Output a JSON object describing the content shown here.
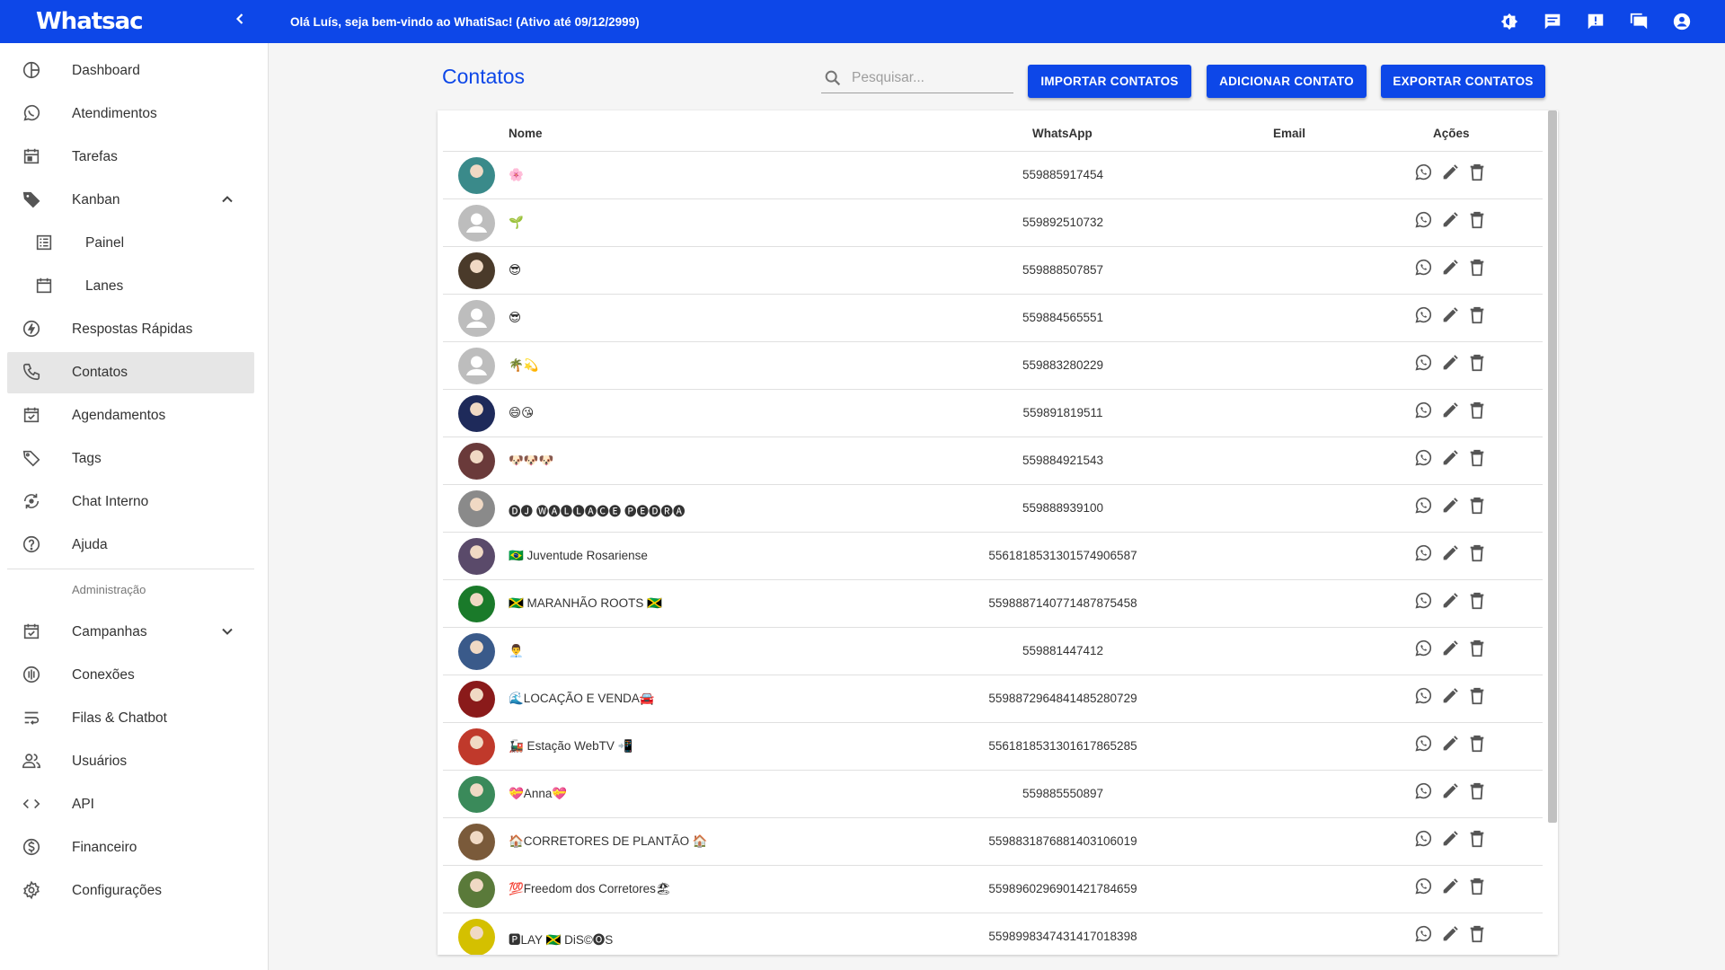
{
  "app": {
    "logo_text": "Whatsac",
    "welcome": "Olá Luís, seja bem-vindo ao WhatiSac! (Ativo até 09/12/2999)",
    "brand_color": "#0d47e8"
  },
  "topbar_icons": [
    "theme-toggle-icon",
    "chat-icon",
    "announcement-icon",
    "forum-icon",
    "account-circle-icon"
  ],
  "sidebar": {
    "items": [
      {
        "label": "Dashboard",
        "icon": "dashboard-icon"
      },
      {
        "label": "Atendimentos",
        "icon": "whatsapp-icon"
      },
      {
        "label": "Tarefas",
        "icon": "calendar-icon"
      },
      {
        "label": "Kanban",
        "icon": "tag-icon"
      },
      {
        "label": "Painel",
        "icon": "list-icon"
      },
      {
        "label": "Lanes",
        "icon": "calendar-blank-icon"
      },
      {
        "label": "Respostas Rápidas",
        "icon": "flash-icon"
      },
      {
        "label": "Contatos",
        "icon": "phone-icon"
      },
      {
        "label": "Agendamentos",
        "icon": "event-check-icon"
      },
      {
        "label": "Tags",
        "icon": "tag-outline-icon"
      },
      {
        "label": "Chat Interno",
        "icon": "chat-sync-icon"
      },
      {
        "label": "Ajuda",
        "icon": "help-icon"
      },
      {
        "label": "Campanhas",
        "icon": "event-available-icon"
      },
      {
        "label": "Conexões",
        "icon": "signal-icon"
      },
      {
        "label": "Filas & Chatbot",
        "icon": "wrap-text-icon"
      },
      {
        "label": "Usuários",
        "icon": "people-icon"
      },
      {
        "label": "API",
        "icon": "code-icon"
      },
      {
        "label": "Financeiro",
        "icon": "dollar-icon"
      },
      {
        "label": "Configurações",
        "icon": "settings-icon"
      }
    ],
    "section_admin": "Administração",
    "active_item": "Contatos"
  },
  "main": {
    "title": "Contatos",
    "search_placeholder": "Pesquisar...",
    "buttons": {
      "import": "IMPORTAR CONTATOS",
      "add": "ADICIONAR CONTATO",
      "export": "EXPORTAR CONTATOS"
    },
    "columns": {
      "name": "Nome",
      "whatsapp": "WhatsApp",
      "email": "Email",
      "actions": "Ações"
    }
  },
  "contacts": [
    {
      "name": "🌸",
      "whatsapp": "559885917454",
      "email": "",
      "avatar": "photo",
      "color": "#3a8a8a"
    },
    {
      "name": "🌱",
      "whatsapp": "559892510732",
      "email": "",
      "avatar": "default",
      "color": "#bdbdbd"
    },
    {
      "name": "😎",
      "whatsapp": "559888507857",
      "email": "",
      "avatar": "photo",
      "color": "#4a3a2a"
    },
    {
      "name": "😎",
      "whatsapp": "559884565551",
      "email": "",
      "avatar": "default",
      "color": "#bdbdbd"
    },
    {
      "name": "🌴💫",
      "whatsapp": "559883280229",
      "email": "",
      "avatar": "default",
      "color": "#bdbdbd"
    },
    {
      "name": "😄😘",
      "whatsapp": "559891819511",
      "email": "",
      "avatar": "photo",
      "color": "#1e2a5a"
    },
    {
      "name": "🐶🐶🐶",
      "whatsapp": "559884921543",
      "email": "",
      "avatar": "photo",
      "color": "#6a3a3a"
    },
    {
      "name": "🅓🅙 🅦🅐🅛🅛🅐🅒🅔 🅟🅔🅓🅡🅐",
      "whatsapp": "559888939100",
      "email": "",
      "avatar": "photo",
      "color": "#8a8a8a"
    },
    {
      "name": "🇧🇷 Juventude Rosariense",
      "whatsapp": "5561818531301574906587",
      "email": "",
      "avatar": "photo",
      "color": "#5a4a6a"
    },
    {
      "name": "🇯🇲 MARANHÃO ROOTS 🇯🇲",
      "whatsapp": "5598887140771487875458",
      "email": "",
      "avatar": "photo",
      "color": "#1a7a2a"
    },
    {
      "name": "👨‍💼",
      "whatsapp": "559881447412",
      "email": "",
      "avatar": "photo",
      "color": "#3a5a8a"
    },
    {
      "name": "🌊LOCAÇÃO E VENDA🚘",
      "whatsapp": "5598872964841485280729",
      "email": "",
      "avatar": "photo",
      "color": "#8a1a1a"
    },
    {
      "name": "🚂 Estação WebTV 📲",
      "whatsapp": "5561818531301617865285",
      "email": "",
      "avatar": "photo",
      "color": "#c0392b"
    },
    {
      "name": "💝Anna💝",
      "whatsapp": "559885550897",
      "email": "",
      "avatar": "photo",
      "color": "#3a8a5a"
    },
    {
      "name": "🏠CORRETORES DE PLANTÃO 🏠",
      "whatsapp": "5598831876881403106019",
      "email": "",
      "avatar": "photo",
      "color": "#7a5a3a"
    },
    {
      "name": "💯Freedom dos Corretores🏖",
      "whatsapp": "5598960296901421784659",
      "email": "",
      "avatar": "photo",
      "color": "#5a7a3a"
    },
    {
      "name": "🅿LA️Y 🇯🇲 DiS©🅞S",
      "whatsapp": "5598998347431417018398",
      "email": "",
      "avatar": "photo",
      "color": "#d4c000"
    }
  ]
}
